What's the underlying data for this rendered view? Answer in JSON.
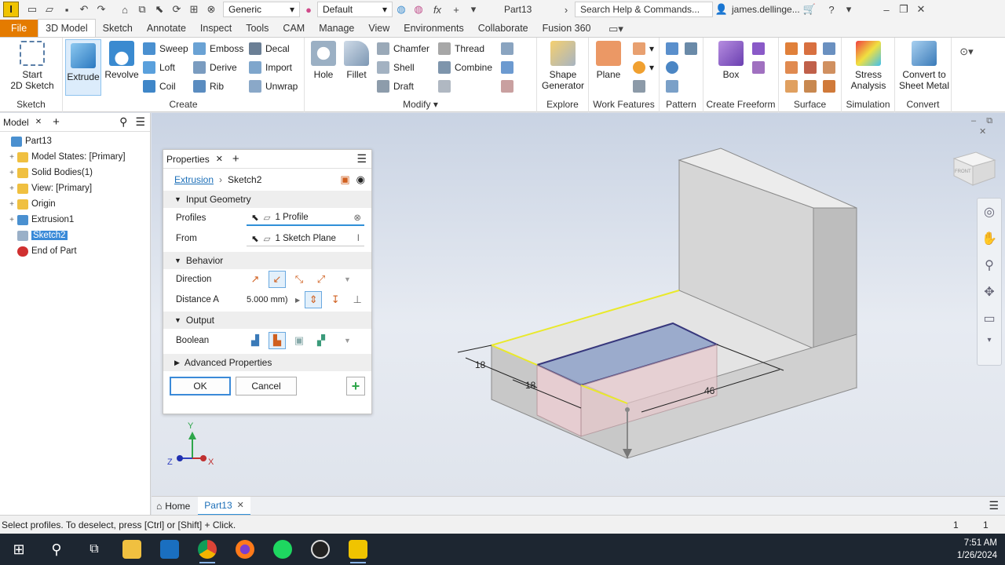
{
  "qat": {
    "logo": "I",
    "material": "Generic",
    "appearance": "Default",
    "fx": "fx",
    "doc_title": "Part13",
    "search_placeholder": "Search Help & Commands...",
    "user": "james.dellinge...",
    "cart_icon": "cart-icon",
    "help_icon": "help-icon"
  },
  "tabs": [
    "3D Model",
    "Sketch",
    "Annotate",
    "Inspect",
    "Tools",
    "CAM",
    "Manage",
    "View",
    "Environments",
    "Collaborate",
    "Fusion 360"
  ],
  "file_tab": "File",
  "active_tab": "3D Model",
  "ribbon": {
    "sketch": {
      "title": "Sketch",
      "start": "Start",
      "start2": "2D Sketch"
    },
    "create": {
      "title": "Create",
      "extrude": "Extrude",
      "revolve": "Revolve",
      "sweep": "Sweep",
      "loft": "Loft",
      "coil": "Coil",
      "emboss": "Emboss",
      "derive": "Derive",
      "rib": "Rib",
      "decal": "Decal",
      "import": "Import",
      "unwrap": "Unwrap"
    },
    "modify": {
      "title": "Modify",
      "hole": "Hole",
      "fillet": "Fillet",
      "chamfer": "Chamfer",
      "shell": "Shell",
      "draft": "Draft",
      "thread": "Thread",
      "combine": "Combine"
    },
    "explore": {
      "title": "Explore",
      "shape1": "Shape",
      "shape2": "Generator"
    },
    "work": {
      "title": "Work Features",
      "plane": "Plane"
    },
    "pattern": {
      "title": "Pattern"
    },
    "freeform": {
      "title": "Create Freeform",
      "box": "Box"
    },
    "surface": {
      "title": "Surface"
    },
    "simulation": {
      "title": "Simulation",
      "stress1": "Stress",
      "stress2": "Analysis"
    },
    "convert": {
      "title": "Convert",
      "c1": "Convert to",
      "c2": "Sheet Metal"
    }
  },
  "browser": {
    "tab": "Model",
    "items": [
      {
        "label": "Part13",
        "indent": 0,
        "expand": ""
      },
      {
        "label": "Model States: [Primary]",
        "indent": 1,
        "expand": "+"
      },
      {
        "label": "Solid Bodies(1)",
        "indent": 1,
        "expand": "+"
      },
      {
        "label": "View: [Primary]",
        "indent": 1,
        "expand": "+"
      },
      {
        "label": "Origin",
        "indent": 1,
        "expand": "+"
      },
      {
        "label": "Extrusion1",
        "indent": 1,
        "expand": "+"
      },
      {
        "label": "Sketch2",
        "indent": 1,
        "expand": ""
      },
      {
        "label": "End of Part",
        "indent": 1,
        "expand": ""
      }
    ]
  },
  "props": {
    "title": "Properties",
    "breadcrumb_link": "Extrusion",
    "breadcrumb_current": "Sketch2",
    "sections": {
      "input": "Input Geometry",
      "behavior": "Behavior",
      "output": "Output",
      "advanced": "Advanced Properties"
    },
    "profiles_label": "Profiles",
    "profiles_value": "1 Profile",
    "from_label": "From",
    "from_value": "1 Sketch Plane",
    "direction_label": "Direction",
    "distance_label": "Distance A",
    "distance_value": "5.000 mm)",
    "boolean_label": "Boolean",
    "ok": "OK",
    "cancel": "Cancel"
  },
  "viewport": {
    "dims": [
      "18",
      "18",
      "46"
    ],
    "viewcube": "FRONT"
  },
  "doctabs": {
    "home": "Home",
    "part": "Part13"
  },
  "status": {
    "message": "Select profiles. To deselect, press [Ctrl] or [Shift] + Click.",
    "n1": "1",
    "n2": "1"
  },
  "taskbar": {
    "time": "7:51 AM",
    "date": "1/26/2024"
  },
  "colors": {
    "accent": "#2f8fd8",
    "file_tab": "#e47b00",
    "taskbar": "#1d2631"
  }
}
